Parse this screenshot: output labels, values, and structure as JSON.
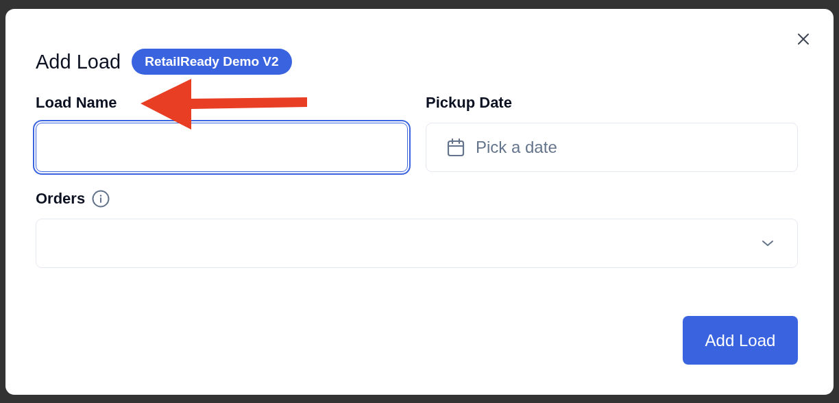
{
  "dialog": {
    "title": "Add Load",
    "badge": "RetailReady Demo V2",
    "fields": [
      {
        "kind": "text",
        "label": "Load Name",
        "focused": true
      },
      {
        "kind": "date",
        "label": "Pickup Date",
        "placeholder": "Pick a date",
        "focused": false
      },
      {
        "kind": "select",
        "label": "Orders",
        "info": true,
        "focused": false
      }
    ],
    "submit_button": "Add Load"
  }
}
